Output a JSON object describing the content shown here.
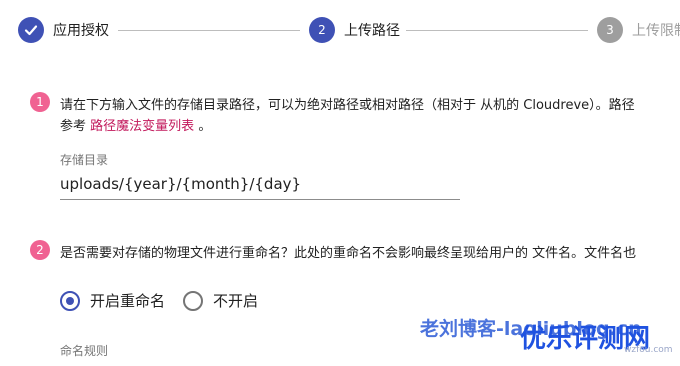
{
  "stepper": {
    "steps": [
      {
        "label": "应用授权",
        "number": "",
        "state": "done"
      },
      {
        "label": "上传路径",
        "number": "2",
        "state": "active"
      },
      {
        "label": "上传限制",
        "number": "3",
        "state": "todo"
      }
    ]
  },
  "section1": {
    "number": "1",
    "line1": "请在下方输入文件的存储目录路径，可以为绝对路径或相对路径（相对于 从机的 Cloudreve）。路径",
    "line2_prefix": "参考",
    "line2_link": "路径魔法变量列表",
    "line2_suffix": "。",
    "field_label": "存储目录",
    "field_value": "uploads/{year}/{month}/{day}"
  },
  "section2": {
    "number": "2",
    "line1": "是否需要对存储的物理文件进行重命名？此处的重命名不会影响最终呈现给用户的 文件名。文件名也",
    "options": [
      {
        "label": "开启重命名",
        "checked": true
      },
      {
        "label": "不开启",
        "checked": false
      }
    ],
    "next_label": "命名规则"
  },
  "watermark": {
    "blue_text": "老刘博客-laoliublog.cn",
    "big_text": "优乐评测网",
    "small_text": "wzfou.com"
  },
  "colors": {
    "primary": "#3f51b5",
    "badge": "#f06292",
    "link": "#c2185b",
    "inactive": "#9e9e9e"
  }
}
